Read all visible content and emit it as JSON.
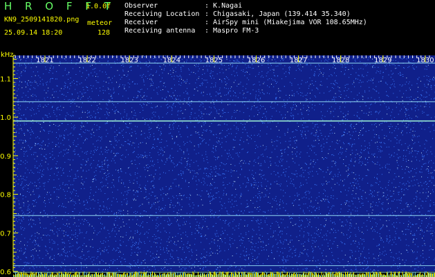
{
  "header": {
    "app_title": "H R O F F T",
    "version": "1.0.0f",
    "filename": "KN9_2509141820.png",
    "mode": "meteor",
    "datetime": "25.09.14 18:20",
    "count": "128",
    "info": [
      {
        "label": "Observer",
        "value": ": K.Nagai"
      },
      {
        "label": "Receiving Location",
        "value": ": Chigasaki, Japan (139.414 35.340)"
      },
      {
        "label": "Receiver",
        "value": ": AirSpy mini (Miakejima VOR 108.65MHz)"
      },
      {
        "label": "Receiving antenna",
        "value": ": Maspro FM-3"
      }
    ]
  },
  "chart_data": {
    "type": "heatmap",
    "ylabel": "kHz",
    "x_ticks": [
      "1821",
      "1822",
      "1823",
      "1824",
      "1825",
      "1826",
      "1827",
      "1828",
      "1829",
      "1830"
    ],
    "y_ticks": [
      "1.1",
      "1.0",
      "0.9",
      "0.8",
      "0.7",
      "0.6"
    ],
    "ylim": [
      0.6,
      1.16
    ],
    "lines_khz": [
      1.14,
      1.04,
      0.99,
      0.745,
      0.615,
      0.598
    ],
    "colors": {
      "background": "#10208a",
      "speckle": "#3b7bff",
      "bright": "#bfe8ff",
      "line": "#9ff0ff",
      "axis": "#ffff00"
    }
  }
}
